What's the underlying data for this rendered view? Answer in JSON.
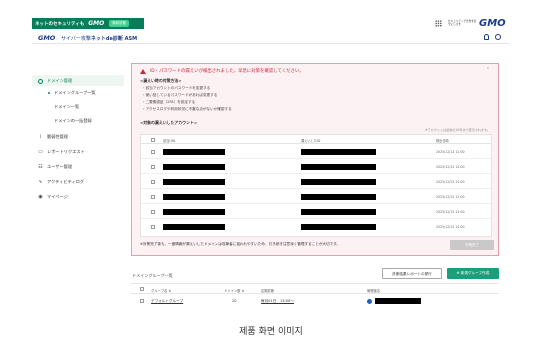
{
  "topbar": {
    "brand": "ネットのセキュリティも",
    "gmo": "GMO",
    "badge": "無料診断",
    "right_text": "セキュリティで世界を安全にします",
    "right_logo": "GMO"
  },
  "header": {
    "logo": "GMO",
    "title_prefix": "サイバー攻撃",
    "title_bold": "ネットde診断 ASM"
  },
  "sidebar": {
    "domain": "ドメイン管理",
    "sub_group": "ドメイングループ一覧",
    "sub_list": "ドメイン一覧",
    "sub_pending": "ドメインの一括登録",
    "vuln": "脆弱性管理",
    "report": "レポートリクエスト",
    "user": "ユーザー管理",
    "activity": "アクティビティログ",
    "mypage": "マイページ"
  },
  "alert": {
    "title": "ID・パスワードの漏えいが検出されました。早急に対策を確認してください。",
    "section_measures": "<漏えい時の対策方法>",
    "measures": [
      "・該当アカウントのパスワードを変更する",
      "・使い回しているパスワードがあれば変更する",
      "・二要素認証（2FA）を設定する",
      "・アクセスログや利用状況に不審な点がないか確認する"
    ],
    "section_accounts": "<対象の漏えいしたアカウント>",
    "note": "※アカウントは最新の10件まで表示されます。",
    "col_url": "該当URL",
    "col_leaked": "漏えいしたID",
    "col_date": "検出日時",
    "rows": [
      {
        "date": "2025/12/12 12:00"
      },
      {
        "date": "2025/12/12 12:00"
      },
      {
        "date": "2025/12/12 12:00"
      },
      {
        "date": "2025/12/12 12:00"
      },
      {
        "date": "2025/12/12 12:00"
      },
      {
        "date": "2025/12/12 12:00"
      }
    ],
    "footer": "※対策完了後も、一度情報が漏えいしたドメインは攻撃者に狙われやすいため、引き続き注意深く管理することが大切です。",
    "done_button": "対策完了"
  },
  "domain_groups": {
    "title": "ドメイングループ一覧",
    "report_button": "診断結果レポートの発行",
    "new_button": "新規グループ作成",
    "col_group": "グループ名",
    "col_count": "ドメイン数",
    "col_schedule": "定期診断",
    "col_manager": "管理者名",
    "row": {
      "group": "デフォルトグループ",
      "count": "20",
      "schedule": "毎月01日　13:00〜"
    }
  },
  "caption": "제품 화면 이미지",
  "colors": {
    "brand_green": "#0a7c5a",
    "alert_red": "#c8263a",
    "alert_bg": "#fdf2f3",
    "primary_button": "#19a07a"
  }
}
